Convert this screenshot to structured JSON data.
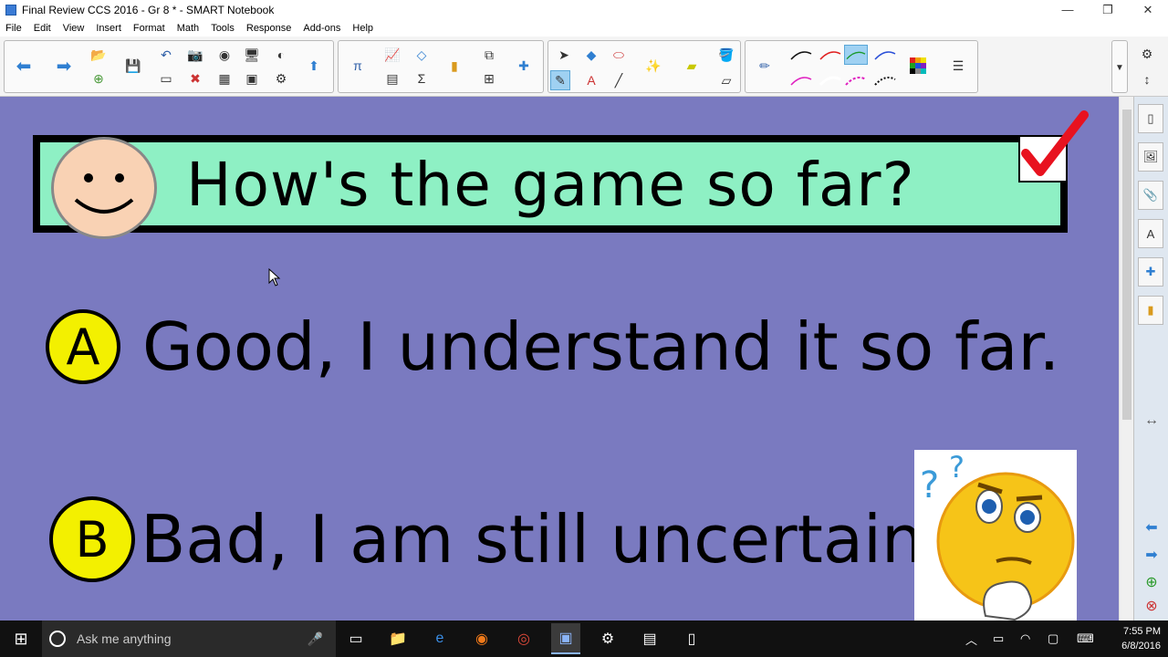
{
  "window": {
    "title": "Final Review CCS 2016 - Gr 8 * - SMART Notebook"
  },
  "menu": [
    "File",
    "Edit",
    "View",
    "Insert",
    "Format",
    "Math",
    "Tools",
    "Response",
    "Add-ons",
    "Help"
  ],
  "slide": {
    "question": "How's the game so far?",
    "answers": [
      {
        "letter": "A",
        "text": "Good, I understand it so far."
      },
      {
        "letter": "B",
        "text": "Bad, I am still uncertain."
      }
    ]
  },
  "taskbar": {
    "search_placeholder": "Ask me anything",
    "time": "7:55 PM",
    "date": "6/8/2016"
  },
  "colors": {
    "canvas": "#7a7ac0",
    "banner": "#8ef0c4",
    "answer_circle": "#f3f000",
    "check": "#e8121f"
  }
}
